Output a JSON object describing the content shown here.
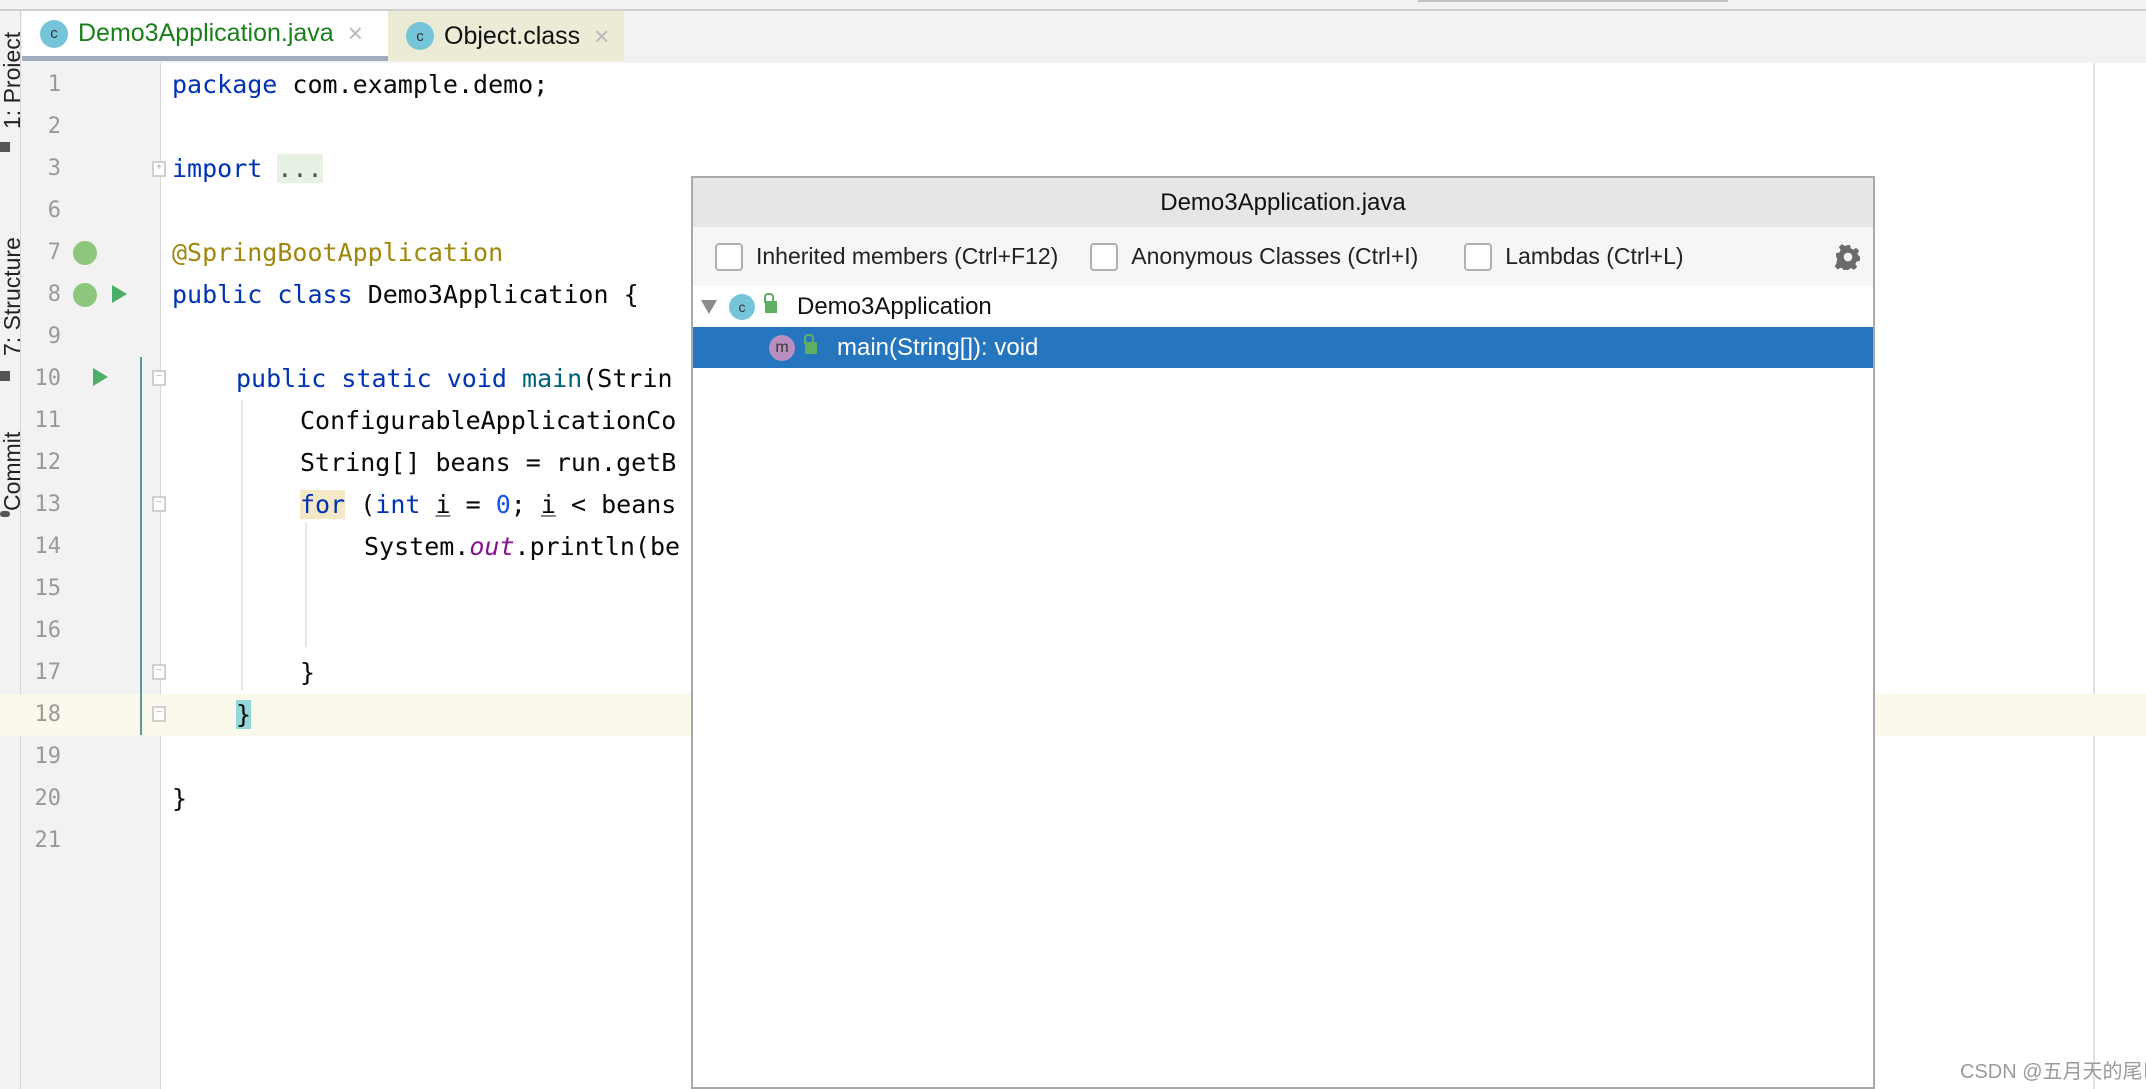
{
  "side_tools": [
    {
      "label": "1: Project",
      "icon": "folder-icon"
    },
    {
      "label": "7: Structure",
      "icon": "structure-icon"
    },
    {
      "label": "Commit",
      "icon": "commit-icon"
    }
  ],
  "tabs": [
    {
      "label": "Demo3Application.java",
      "icon": "spring-class-icon",
      "active": true,
      "close": "×"
    },
    {
      "label": "Object.class",
      "icon": "locked-class-icon",
      "active": false,
      "close": "×"
    }
  ],
  "editor": {
    "line_numbers": [
      "1",
      "2",
      "3",
      "6",
      "7",
      "8",
      "9",
      "10",
      "11",
      "12",
      "13",
      "14",
      "15",
      "16",
      "17",
      "18",
      "19",
      "20",
      "21"
    ],
    "lines": {
      "l1": {
        "kw": "package",
        "rest": " com.example.demo;"
      },
      "l3": {
        "kw": "import",
        "folded": "..."
      },
      "l7": {
        "annotation": "@SpringBootApplication"
      },
      "l8": {
        "kw1": "public",
        "kw2": "class",
        "rest": " Demo3Application {"
      },
      "l10": {
        "kw1": "public",
        "kw2": "static",
        "kw3": "void",
        "fn": "main",
        "rest": "(Strin"
      },
      "l11": {
        "text": "ConfigurableApplicationCo"
      },
      "l12": {
        "text": "String[] beans = run.getB"
      },
      "l13": {
        "kw": "for",
        "p1": " (",
        "kw2": "int",
        "p2": " ",
        "var1": "i",
        "p3": " = ",
        "num": "0",
        "p4": "; ",
        "var2": "i",
        "p5": " < beans"
      },
      "l14": {
        "pre": "System.",
        "field": "out",
        "post": ".println(be"
      },
      "l17": {
        "text": "}"
      },
      "l18": {
        "text": "}"
      },
      "l20": {
        "text": "}"
      }
    },
    "current_line": "18"
  },
  "popup": {
    "title": "Demo3Application.java",
    "options": [
      {
        "label": "Inherited members (Ctrl+F12)",
        "checked": false
      },
      {
        "label": "Anonymous Classes (Ctrl+I)",
        "checked": false
      },
      {
        "label": "Lambdas (Ctrl+L)",
        "checked": false
      }
    ],
    "settings_icon": "gear-icon",
    "tree": [
      {
        "label": "Demo3Application",
        "icon": "spring-class-icon",
        "expanded": true,
        "selected": false
      },
      {
        "label": "main(String[]): void",
        "icon": "method-icon",
        "selected": true
      }
    ],
    "selection_color": "#2675bf"
  },
  "watermark": "CSDN @五月天的尾巴"
}
